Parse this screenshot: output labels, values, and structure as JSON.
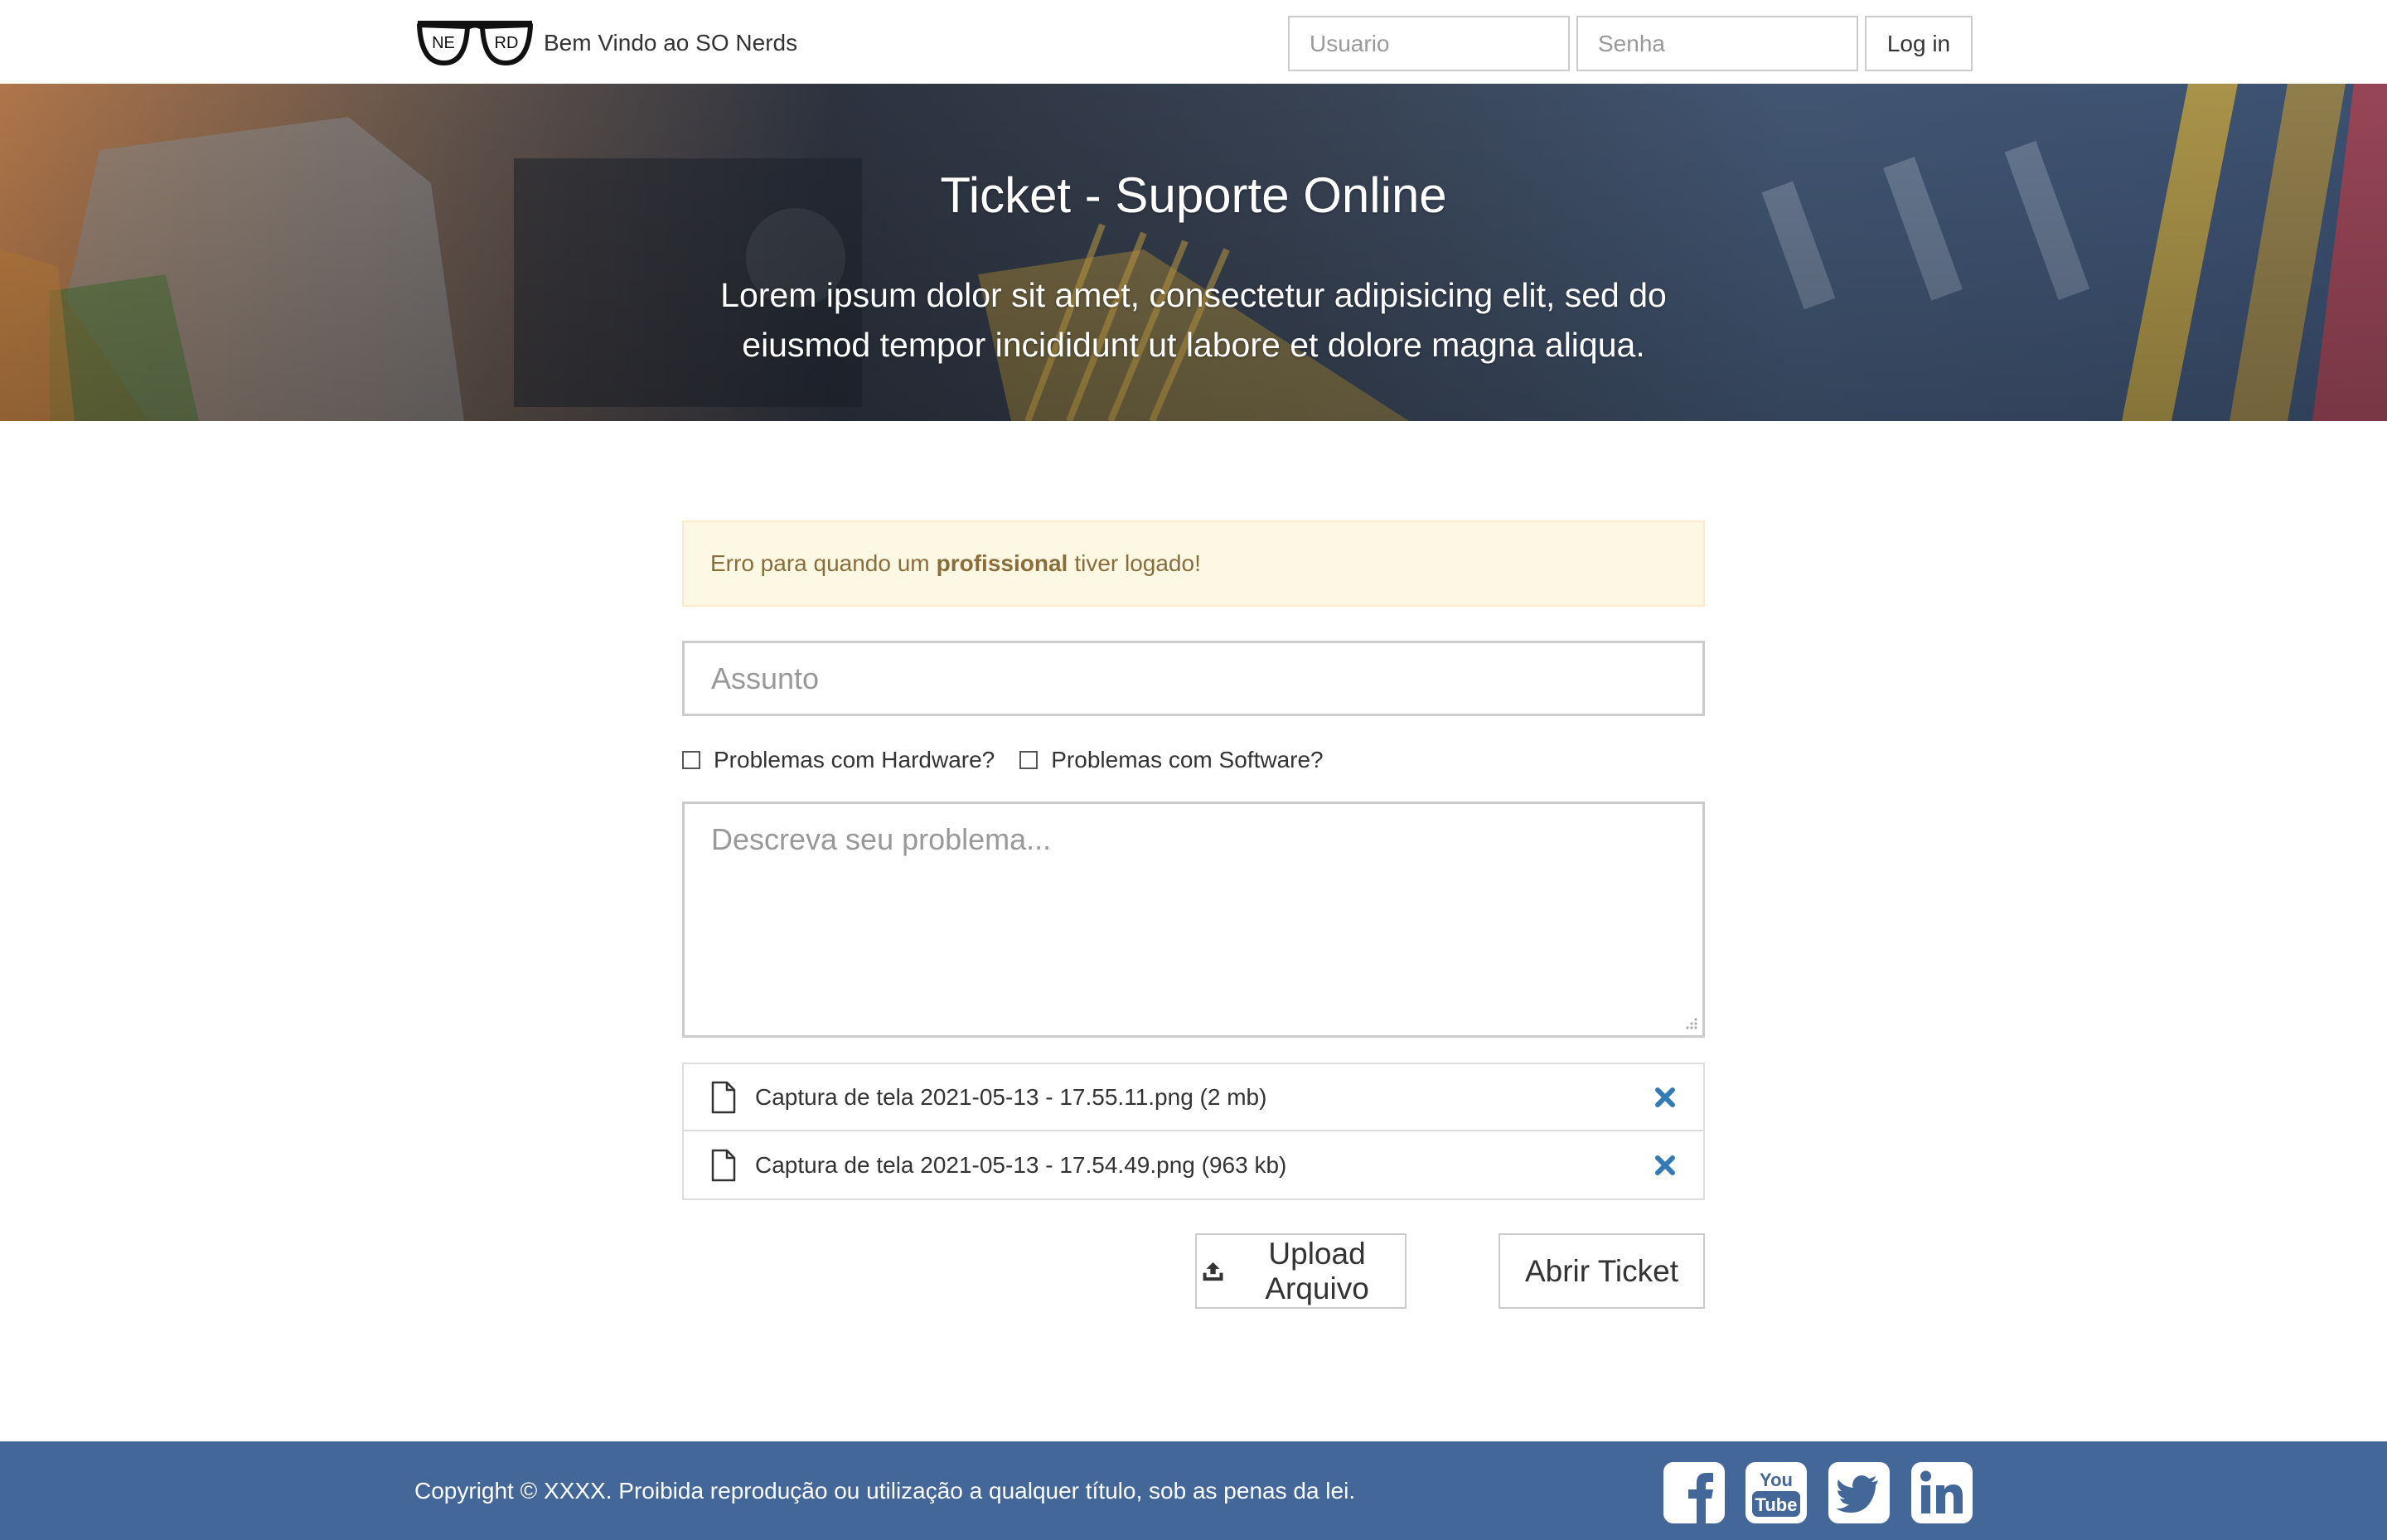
{
  "navbar": {
    "logo_letters": [
      "NE",
      "RD"
    ],
    "brand_text": "Bem Vindo ao SO Nerds",
    "username_placeholder": "Usuario",
    "password_placeholder": "Senha",
    "login_label": "Log in"
  },
  "hero": {
    "title": "Ticket - Suporte Online",
    "subtitle": "Lorem ipsum dolor sit amet, consectetur adipisicing elit, sed do eiusmod tempor incididunt ut labore et dolore magna aliqua."
  },
  "alert": {
    "text_before": "Erro para quando um",
    "text_bold": "profissional",
    "text_after": "tiver logado!"
  },
  "form": {
    "subject_placeholder": "Assunto",
    "checkbox_hardware": "Problemas com Hardware?",
    "checkbox_software": "Problemas com Software?",
    "description_placeholder": "Descreva seu problema..."
  },
  "files": [
    {
      "label": "Captura de tela 2021-05-13 - 17.55.11.png (2 mb)",
      "icon": "file-icon",
      "remove_icon": "remove-icon"
    },
    {
      "label": "Captura de tela 2021-05-13 - 17.54.49.png (963 kb)",
      "icon": "file-icon",
      "remove_icon": "remove-icon"
    }
  ],
  "buttons": {
    "upload_label": "Upload Arquivo",
    "open_ticket_label": "Abrir Ticket"
  },
  "footer": {
    "copyright": "Copyright © XXXX. Proibida reprodução ou utilização a qualquer título, sob as penas da lei.",
    "social": [
      "facebook-icon",
      "youtube-icon",
      "twitter-icon",
      "linkedin-icon"
    ],
    "youtube_text": [
      "You",
      "Tube"
    ]
  },
  "colors": {
    "footer_bg": "#44679a",
    "alert_bg": "#fcf8e3",
    "alert_text": "#8a6d3b",
    "remove_icon": "#337ab7"
  }
}
